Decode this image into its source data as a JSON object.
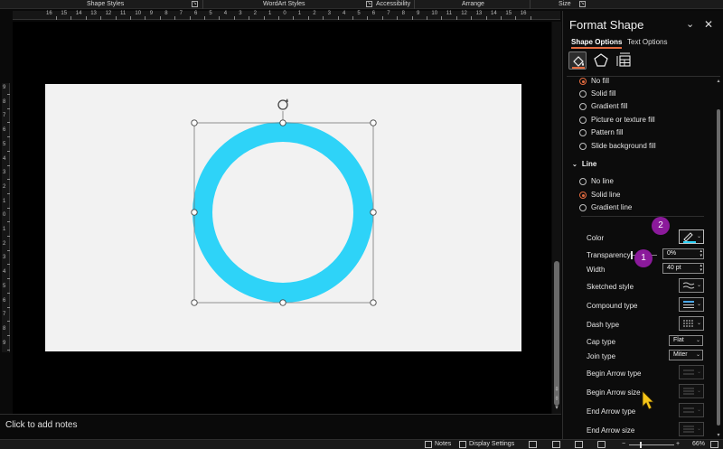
{
  "ribbon": {
    "groups": [
      "Shape Styles",
      "WordArt Styles",
      "Accessibility",
      "Arrange",
      "Size"
    ]
  },
  "ruler_top": [
    "16",
    "15",
    "14",
    "13",
    "12",
    "11",
    "10",
    "9",
    "8",
    "7",
    "6",
    "5",
    "4",
    "3",
    "2",
    "1",
    "0",
    "1",
    "2",
    "3",
    "4",
    "5",
    "6",
    "7",
    "8",
    "9",
    "10",
    "11",
    "12",
    "13",
    "14",
    "15",
    "16"
  ],
  "ruler_left": [
    "9",
    "8",
    "7",
    "6",
    "5",
    "4",
    "3",
    "2",
    "1",
    "0",
    "1",
    "2",
    "3",
    "4",
    "5",
    "6",
    "7",
    "8",
    "9"
  ],
  "shape": {
    "ring_color": "#2ed3f8",
    "handle_color": "#ffffff"
  },
  "notes": {
    "placeholder": "Click to add notes"
  },
  "statusbar": {
    "notes_label": "Notes",
    "display_settings_label": "Display Settings",
    "zoom_label": "66%"
  },
  "pane": {
    "title": "Format Shape",
    "tabs": [
      "Shape Options",
      "Text Options"
    ],
    "accent": "#e36b3f",
    "fill_options": [
      "No fill",
      "Solid fill",
      "Gradient fill",
      "Picture or texture fill",
      "Pattern fill",
      "Slide background fill"
    ],
    "line_section": "Line",
    "line_options": [
      "No line",
      "Solid line",
      "Gradient line"
    ],
    "line_selected": "Solid line",
    "properties": {
      "color": "Color",
      "transparency": "Transparency",
      "transparency_value": "0%",
      "width": "Width",
      "width_value": "40 pt",
      "sketched_style": "Sketched style",
      "compound_type": "Compound type",
      "dash_type": "Dash type",
      "cap_type": "Cap type",
      "cap_type_value": "Flat",
      "join_type": "Join type",
      "join_type_value": "Miter",
      "begin_arrow_type": "Begin Arrow type",
      "begin_arrow_size": "Begin Arrow size",
      "end_arrow_type": "End Arrow type",
      "end_arrow_size": "End Arrow size"
    }
  },
  "callouts": [
    "1",
    "2"
  ],
  "callout_color": "#8b1a9b",
  "cursor_color": "#f5c518"
}
